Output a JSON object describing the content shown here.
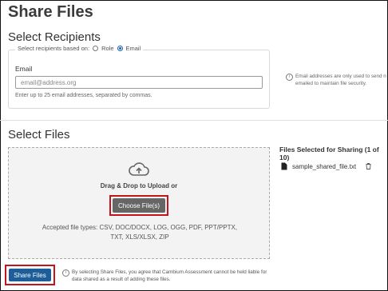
{
  "page": {
    "title": "Share Files"
  },
  "recipients": {
    "heading": "Select Recipients",
    "legend": "Select recipients based on:",
    "options": [
      {
        "label": "Role",
        "selected": false
      },
      {
        "label": "Email",
        "selected": true
      }
    ],
    "email_label": "Email",
    "email_placeholder": "email@address.org",
    "email_value": "",
    "email_help": "Enter up to 25 email addresses, separated by commas.",
    "info_note_line1": "Email addresses are only used to send n",
    "info_note_line2": "emailed to maintain file security."
  },
  "files": {
    "heading": "Select Files",
    "drop_label": "Drag & Drop to Upload or",
    "choose_button": "Choose File(s)",
    "accepted_types": "Accepted file types: CSV, DOC/DOCX, LOG, OGG, PDF, PPT/PPTX, TXT, XLS/XLSX, ZIP",
    "selected_title": "Files Selected for Sharing (1 of 10)",
    "selected_files": [
      {
        "name": "sample_shared_file.txt"
      }
    ]
  },
  "footer": {
    "share_button": "Share Files",
    "note_line1": "By selecting Share Files, you agree that Cambium Assessment cannot be held liable for",
    "note_line2": "data shared as a result of adding these files."
  },
  "colors": {
    "accent": "#1d5d99",
    "highlight": "#c1141b",
    "muted_button": "#666666"
  },
  "icons": [
    "cloud-upload-icon",
    "file-icon",
    "trash-icon",
    "info-icon"
  ]
}
